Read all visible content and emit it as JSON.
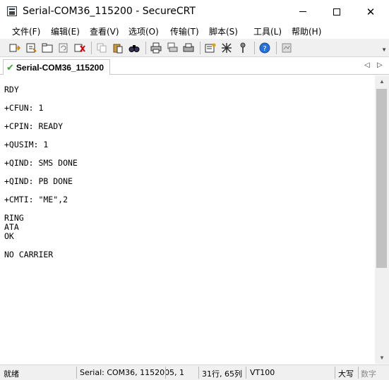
{
  "window": {
    "title": "Serial-COM36_115200 - SecureCRT",
    "minimize": "—",
    "maximize": "☐",
    "close": "✕"
  },
  "menu": [
    "文件(F)",
    "编辑(E)",
    "查看(V)",
    "选项(O)",
    "传输(T)",
    "脚本(S)",
    "工具(L)",
    "帮助(H)"
  ],
  "toolbar_icons": [
    "connect-icon",
    "quick-connect-icon",
    "connect-in-tab-icon",
    "reconnect-icon",
    "disconnect-icon",
    "copy-icon",
    "paste-icon",
    "find-icon",
    "print-icon",
    "print-selection-icon",
    "print-setup-icon",
    "session-options-icon",
    "global-options-icon",
    "keymap-icon",
    "help-icon",
    "extra-icon"
  ],
  "tab": {
    "label": "Serial-COM36_115200",
    "status_icon": "connected-check-icon"
  },
  "terminal_lines": [
    "RDY",
    "",
    "+CFUN: 1",
    "",
    "+CPIN: READY",
    "",
    "+QUSIM: 1",
    "",
    "+QIND: SMS DONE",
    "",
    "+QIND: PB DONE",
    "",
    "+CMTI: \"ME\",2",
    "",
    "RING",
    "ATA",
    "OK",
    "",
    "NO CARRIER"
  ],
  "status": {
    "ready": "就绪",
    "session": "Serial: COM36, 115200",
    "position": "5,   1",
    "size": "31行, 65列",
    "terminal": "VT100",
    "caps": "大写",
    "num": "数字"
  },
  "colors": {
    "toolbar_bg": "#f0f0f0",
    "tab_check": "#3aa33a",
    "scroll_thumb": "#c1c1c1"
  }
}
